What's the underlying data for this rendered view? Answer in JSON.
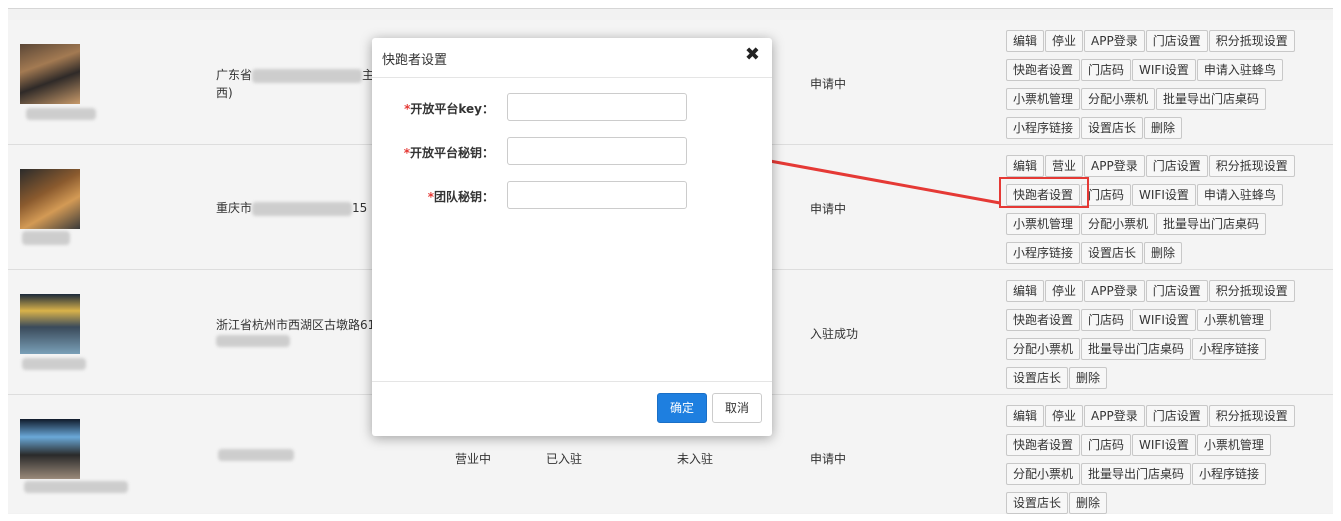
{
  "modal": {
    "title": "快跑者设置",
    "fields": [
      {
        "label": "开放平台key：",
        "value": ""
      },
      {
        "label": "开放平台秘钥：",
        "value": ""
      },
      {
        "label": "团队秘钥：",
        "value": ""
      }
    ],
    "ok_label": "确定",
    "cancel_label": "取消"
  },
  "rows": [
    {
      "address": "广东省",
      "address_frag": "主",
      "address_line2": "西)",
      "apply_status": "申请中",
      "ops": [
        "编辑",
        "停业",
        "APP登录",
        "门店设置",
        "积分抵现设置",
        "快跑者设置",
        "门店码",
        "WIFI设置",
        "申请入驻蜂鸟",
        "小票机管理",
        "分配小票机",
        "批量导出门店桌码",
        "小程序链接",
        "设置店长",
        "删除"
      ]
    },
    {
      "address": "重庆市",
      "address_frag": "15",
      "apply_status": "申请中",
      "ops": [
        "编辑",
        "营业",
        "APP登录",
        "门店设置",
        "积分抵现设置",
        "快跑者设置",
        "门店码",
        "WIFI设置",
        "申请入驻蜂鸟",
        "小票机管理",
        "分配小票机",
        "批量导出门店桌码",
        "小程序链接",
        "设置店长",
        "删除"
      ]
    },
    {
      "address": "浙江省杭州市西湖区古墩路61",
      "apply_status": "入驻成功",
      "ops": [
        "编辑",
        "停业",
        "APP登录",
        "门店设置",
        "积分抵现设置",
        "快跑者设置",
        "门店码",
        "WIFI设置",
        "小票机管理",
        "分配小票机",
        "批量导出门店桌码",
        "小程序链接",
        "设置店长",
        "删除"
      ]
    },
    {
      "business_status": "营业中",
      "settle_status": "已入驻",
      "fengniao_status": "未入驻",
      "apply_status": "申请中",
      "ops": [
        "编辑",
        "停业",
        "APP登录",
        "门店设置",
        "积分抵现设置",
        "快跑者设置",
        "门店码",
        "WIFI设置",
        "小票机管理",
        "分配小票机",
        "批量导出门店桌码",
        "小程序链接",
        "设置店长",
        "删除"
      ]
    }
  ],
  "annotation": {
    "color": "#e53935"
  }
}
